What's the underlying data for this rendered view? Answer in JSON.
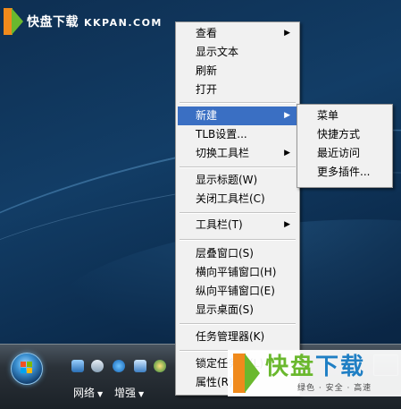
{
  "watermark_top": {
    "cn": "快盘下载",
    "en": "KKPAN.COM"
  },
  "main_menu": {
    "items": [
      {
        "label": "查看",
        "submenu": true
      },
      {
        "label": "显示文本"
      },
      {
        "label": "刷新"
      },
      {
        "label": "打开"
      },
      {
        "label": "新建",
        "submenu": true,
        "highlighted": true
      },
      {
        "label": "TLB设置..."
      },
      {
        "label": "切换工具栏",
        "submenu": true
      },
      {
        "label": "显示标题(W)"
      },
      {
        "label": "关闭工具栏(C)"
      },
      {
        "label": "工具栏(T)",
        "submenu": true
      },
      {
        "label": "层叠窗口(S)"
      },
      {
        "label": "横向平铺窗口(H)"
      },
      {
        "label": "纵向平铺窗口(E)"
      },
      {
        "label": "显示桌面(S)"
      },
      {
        "label": "任务管理器(K)"
      },
      {
        "label": "锁定任务栏(L)"
      },
      {
        "label": "属性(R)"
      }
    ]
  },
  "sub_menu": {
    "items": [
      {
        "label": "菜单"
      },
      {
        "label": "快捷方式"
      },
      {
        "label": "最近访问"
      },
      {
        "label": "更多插件..."
      }
    ]
  },
  "taskbar": {
    "network_label": "网络",
    "enhance_label": "增强",
    "quick_launch_icons": [
      "ie-settings-icon",
      "user-icon",
      "internet-explorer-icon",
      "document-icon",
      "network-people-icon"
    ]
  },
  "watermark_bottom": {
    "title_1": "快盘",
    "title_2": "下载",
    "subtitle": "绿色 · 安全 · 高速"
  },
  "colors": {
    "menu_highlight": "#3a6fc3",
    "menu_background": "#f1f1f1",
    "desktop": "#123d66",
    "brand_orange": "#f08a1c",
    "brand_green": "#6ab82e",
    "brand_blue": "#1f7fc4"
  }
}
